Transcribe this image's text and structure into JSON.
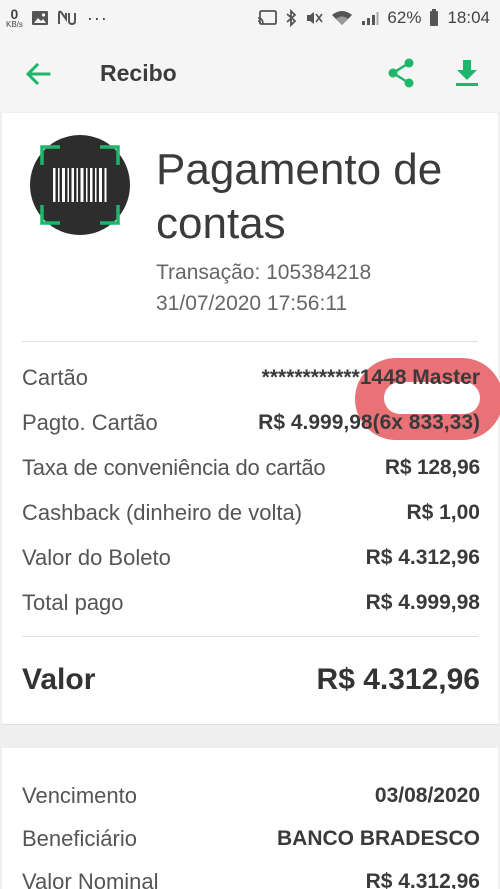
{
  "status_bar": {
    "speed_value": "0",
    "speed_unit": "KB/s",
    "battery_pct": "62%",
    "time": "18:04",
    "icons": [
      "image-icon",
      "nu-icon",
      "overflow-dots-icon",
      "cast-icon",
      "bluetooth-icon",
      "mute-icon",
      "wifi-icon",
      "signal-icon",
      "battery-icon"
    ]
  },
  "app_bar": {
    "title": "Recibo",
    "accent_color": "#1fb56a"
  },
  "receipt": {
    "title": "Pagamento de contas",
    "transaction": "Transação: 105384218",
    "datetime": "31/07/2020 17:56:11",
    "rows": [
      {
        "label": "Cartão",
        "value": "************1448 Master"
      },
      {
        "label": "Pagto. Cartão",
        "value": "R$ 4.999,98(6x 833,33)"
      },
      {
        "label": "Taxa de conveniência do cartão",
        "value": "R$ 128,96"
      },
      {
        "label": "Cashback (dinheiro de volta)",
        "value": "R$ 1,00"
      },
      {
        "label": "Valor do Boleto",
        "value": "R$ 4.312,96"
      },
      {
        "label": "Total pago",
        "value": "R$ 4.999,98"
      }
    ],
    "total_label": "Valor",
    "total_value": "R$ 4.312,96",
    "highlight_color": "#e86a70"
  },
  "boleto": {
    "rows": [
      {
        "label": "Vencimento",
        "value": "03/08/2020"
      },
      {
        "label": "Beneficiário",
        "value": "BANCO BRADESCO"
      },
      {
        "label": "Valor Nominal",
        "value": "R$ 4.312,96"
      }
    ]
  }
}
